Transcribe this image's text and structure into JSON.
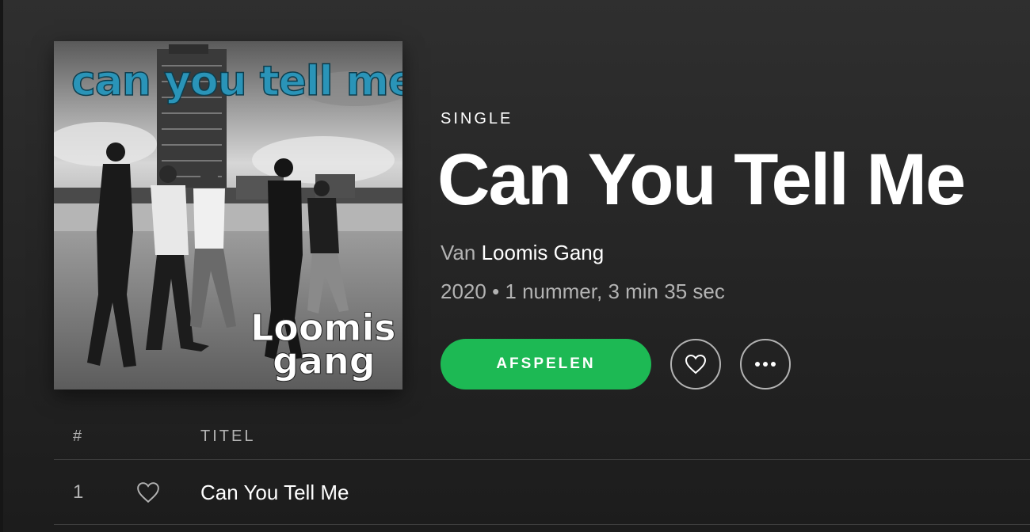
{
  "album": {
    "type_label": "SINGLE",
    "title": "Can You Tell Me",
    "by_prefix": "Van",
    "artist": "Loomis Gang",
    "meta": "2020 • 1 nummer, 3 min 35 sec"
  },
  "cover": {
    "headline": "can you tell me",
    "band_line1": "Loomis",
    "band_line2": "gang",
    "headline_color": "#2a94b8"
  },
  "actions": {
    "play_label": "AFSPELEN",
    "like_icon": "heart-icon",
    "more_icon": "more-icon"
  },
  "tracklist": {
    "columns": [
      "#",
      "TITEL"
    ],
    "tracks": [
      {
        "number": "1",
        "title": "Can You Tell Me"
      }
    ]
  },
  "colors": {
    "accent": "#1db954",
    "text_secondary": "#b3b3b3",
    "background": "#262626"
  }
}
